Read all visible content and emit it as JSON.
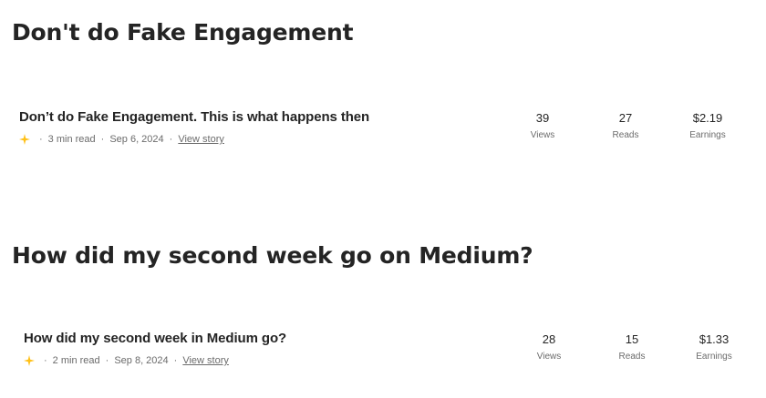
{
  "sections": [
    {
      "heading": "Don't do Fake Engagement",
      "story": {
        "title": "Don’t do Fake Engagement. This is what happens then",
        "read_time": "3 min read",
        "date": "Sep 6, 2024",
        "view_link": "View story",
        "stats": {
          "views_value": "39",
          "views_label": "Views",
          "reads_value": "27",
          "reads_label": "Reads",
          "earnings_value": "$2.19",
          "earnings_label": "Earnings"
        }
      }
    },
    {
      "heading": "How did my second week go on Medium?",
      "story": {
        "title": "How did my second week in Medium go?",
        "read_time": "2 min read",
        "date": "Sep 8, 2024",
        "view_link": "View story",
        "stats": {
          "views_value": "28",
          "views_label": "Views",
          "reads_value": "15",
          "reads_label": "Reads",
          "earnings_value": "$1.33",
          "earnings_label": "Earnings"
        }
      }
    }
  ],
  "separator": "·",
  "icons": {
    "member_story": "star-icon"
  },
  "colors": {
    "star": "#ffc017",
    "text_primary": "#242424",
    "text_secondary": "#6b6b6b"
  }
}
